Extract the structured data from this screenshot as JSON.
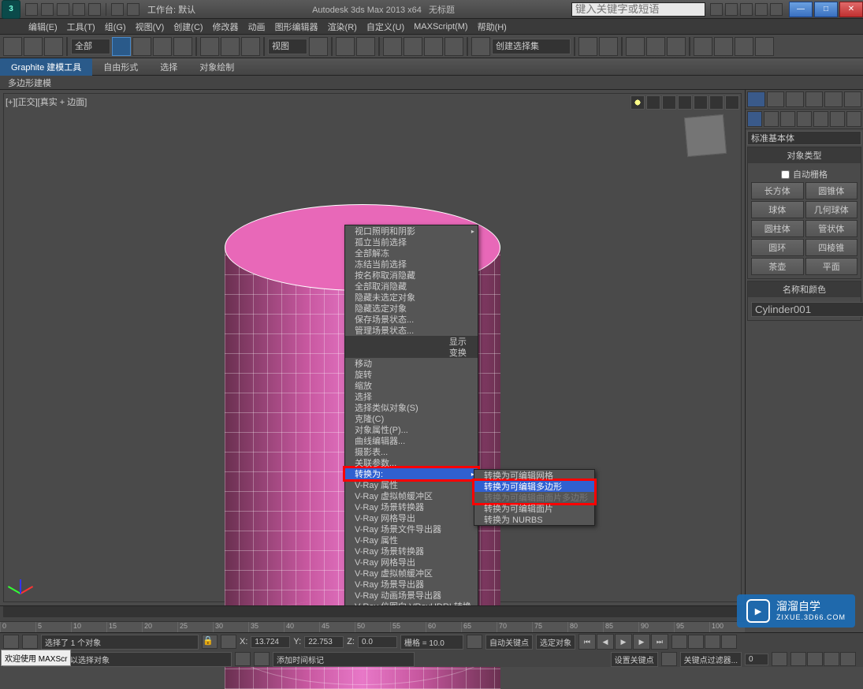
{
  "titlebar": {
    "app_icon": "3",
    "workspace": "工作台: 默认",
    "product": "Autodesk 3ds Max  2013 x64",
    "doc": "无标题",
    "search_placeholder": "键入关键字或短语",
    "min": "—",
    "max": "□",
    "close": "✕"
  },
  "menubar": [
    "编辑(E)",
    "工具(T)",
    "组(G)",
    "视图(V)",
    "创建(C)",
    "修改器",
    "动画",
    "图形编辑器",
    "渲染(R)",
    "自定义(U)",
    "MAXScript(M)",
    "帮助(H)"
  ],
  "toolbar": {
    "dd_all": "全部",
    "dd_view": "视图",
    "selset": "创建选择集"
  },
  "ribbon": {
    "tabs": [
      "Graphite 建模工具",
      "自由形式",
      "选择",
      "对象绘制"
    ],
    "sub": "多边形建模"
  },
  "viewport": {
    "label": "[+][正交][真实 + 边面]"
  },
  "ctx": {
    "items1": [
      "视口照明和阴影",
      "孤立当前选择",
      "全部解冻",
      "冻结当前选择",
      "按名称取消隐藏",
      "全部取消隐藏",
      "隐藏未选定对象",
      "隐藏选定对象",
      "保存场景状态...",
      "管理场景状态..."
    ],
    "sec1": "显示",
    "sec2": "变换",
    "items2": [
      "移动",
      "旋转",
      "缩放",
      "选择",
      "选择类似对象(S)",
      "克隆(C)",
      "对象属性(P)...",
      "曲线编辑器...",
      "摄影表...",
      "关联参数..."
    ],
    "convert": "转换为:",
    "items3": [
      "V-Ray 属性",
      "V-Ray 虚拟帧缓冲区",
      "V-Ray 场景转换器",
      "V-Ray 网格导出",
      "V-Ray 场景文件导出器",
      "V-Ray 属性",
      "V-Ray 场景转换器",
      "V-Ray 网格导出",
      "V-Ray 虚拟帧缓冲区",
      "V-Ray 场景导出器",
      "V-Ray 动画场景导出器",
      "V-Ray 位图向 VRayHDRI 转换"
    ],
    "sub_items": [
      "转换为可编辑网格",
      "转换为可编辑多边形",
      "转换为可编辑曲面片多边形",
      "转换为可编辑面片",
      "转换为 NURBS"
    ]
  },
  "cmd": {
    "dd": "标准基本体",
    "roll1": "对象类型",
    "autogrid": "自动栅格",
    "prims": [
      "长方体",
      "圆锥体",
      "球体",
      "几何球体",
      "圆柱体",
      "管状体",
      "圆环",
      "四棱锥",
      "茶壶",
      "平面"
    ],
    "roll2": "名称和颜色",
    "objname": "Cylinder001"
  },
  "status": {
    "frame": "0 / 100",
    "sel": "选择了 1 个对象",
    "hint": "单击或单击并拖动以选择对象",
    "x": "13.724",
    "y": "22.753",
    "z": "0.0",
    "grid": "栅格 = 10.0",
    "autokey": "自动关键点",
    "setkey": "设置关键点",
    "selset": "选定对象",
    "keyfilter": "关键点过滤器...",
    "addmarker": "添加时间标记",
    "welcome": "欢迎使用  MAXScr"
  },
  "ruler": [
    "0",
    "5",
    "10",
    "15",
    "20",
    "25",
    "30",
    "35",
    "40",
    "45",
    "50",
    "55",
    "60",
    "65",
    "70",
    "75",
    "80",
    "85",
    "90",
    "95",
    "100"
  ],
  "watermark": {
    "brand": "溜溜自学",
    "url": "ZIXUE.3D66.COM"
  }
}
